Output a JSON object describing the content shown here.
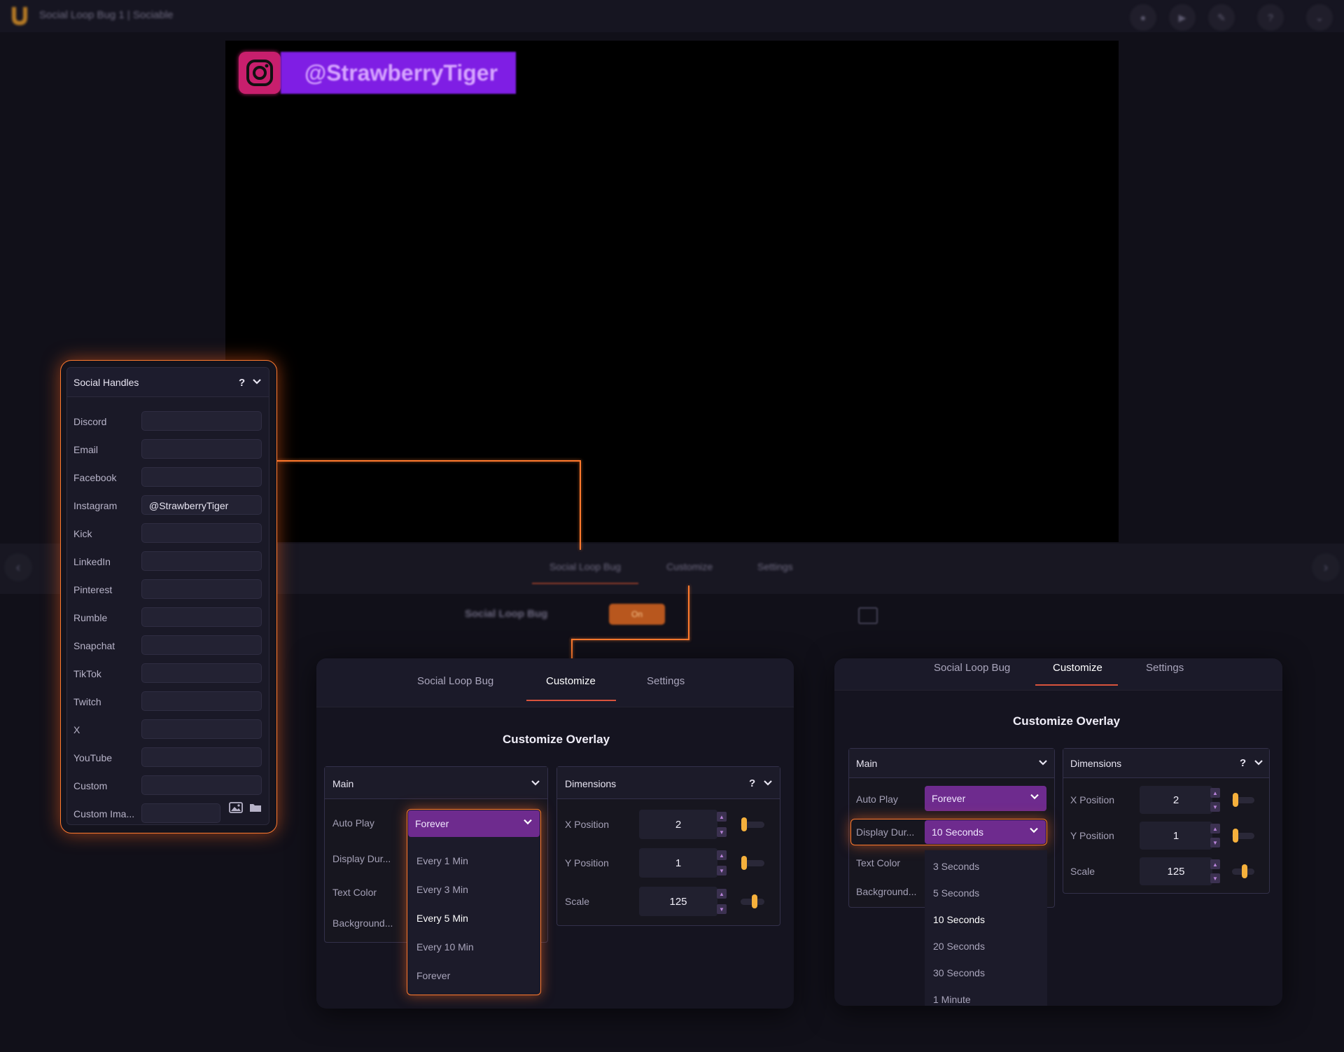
{
  "app": {
    "title": "Social Loop Bug 1 | Sociable"
  },
  "window_buttons": [
    "record-icon",
    "play-icon",
    "pin-icon",
    "help-icon",
    "chevron-down-icon"
  ],
  "preview": {
    "handle": "@StrawberryTiger",
    "platform_icon": "instagram-icon"
  },
  "background_tabs": {
    "items": [
      "Social Loop Bug",
      "Customize",
      "Settings"
    ],
    "row_label": "Social Loop Bug",
    "toggle_label": "On"
  },
  "handles_panel": {
    "title": "Social Handles",
    "help": "?",
    "rows": [
      {
        "label": "Discord",
        "value": ""
      },
      {
        "label": "Email",
        "value": ""
      },
      {
        "label": "Facebook",
        "value": ""
      },
      {
        "label": "Instagram",
        "value": "@StrawberryTiger"
      },
      {
        "label": "Kick",
        "value": ""
      },
      {
        "label": "LinkedIn",
        "value": ""
      },
      {
        "label": "Pinterest",
        "value": ""
      },
      {
        "label": "Rumble",
        "value": ""
      },
      {
        "label": "Snapchat",
        "value": ""
      },
      {
        "label": "TikTok",
        "value": ""
      },
      {
        "label": "Twitch",
        "value": ""
      },
      {
        "label": "X",
        "value": ""
      },
      {
        "label": "YouTube",
        "value": ""
      },
      {
        "label": "Custom",
        "value": ""
      },
      {
        "label": "Custom Ima...",
        "value": ""
      }
    ]
  },
  "left_panel": {
    "tabs": [
      "Social Loop Bug",
      "Customize",
      "Settings"
    ],
    "active_tab": "Customize",
    "heading": "Customize Overlay",
    "main_card": {
      "title": "Main",
      "fields": [
        "Auto Play",
        "Display Dur...",
        "Text Color",
        "Background..."
      ],
      "auto_play_value": "Forever",
      "auto_play_options": [
        "Every 1 Min",
        "Every 3 Min",
        "Every 5 Min",
        "Every 10 Min",
        "Forever"
      ]
    },
    "dimensions_card": {
      "title": "Dimensions",
      "help": "?",
      "fields": [
        {
          "label": "X Position",
          "value": "2",
          "level": 0.05
        },
        {
          "label": "Y Position",
          "value": "1",
          "level": 0.03
        },
        {
          "label": "Scale",
          "value": "125",
          "level": 0.6
        }
      ]
    }
  },
  "right_panel": {
    "tabs": [
      "Social Loop Bug",
      "Customize",
      "Settings"
    ],
    "active_tab": "Customize",
    "heading": "Customize Overlay",
    "main_card": {
      "title": "Main",
      "fields": [
        "Auto Play",
        "Display Dur...",
        "Text Color",
        "Background..."
      ],
      "auto_play_value": "Forever",
      "display_duration_value": "10 Seconds",
      "display_duration_options": [
        "3 Seconds",
        "5 Seconds",
        "10 Seconds",
        "20 Seconds",
        "30 Seconds",
        "1 Minute"
      ]
    },
    "dimensions_card": {
      "title": "Dimensions",
      "help": "?",
      "fields": [
        {
          "label": "X Position",
          "value": "2",
          "level": 0.05
        },
        {
          "label": "Y Position",
          "value": "1",
          "level": 0.03
        },
        {
          "label": "Scale",
          "value": "125",
          "level": 0.6
        }
      ]
    }
  },
  "colors": {
    "accent_orange": "#ff7a2e",
    "select_purple": "#6e2b8e",
    "slider_thumb": "#f5b03c",
    "instagram_pink": "#c81f6d",
    "banner_purple": "#7f1ee4"
  }
}
